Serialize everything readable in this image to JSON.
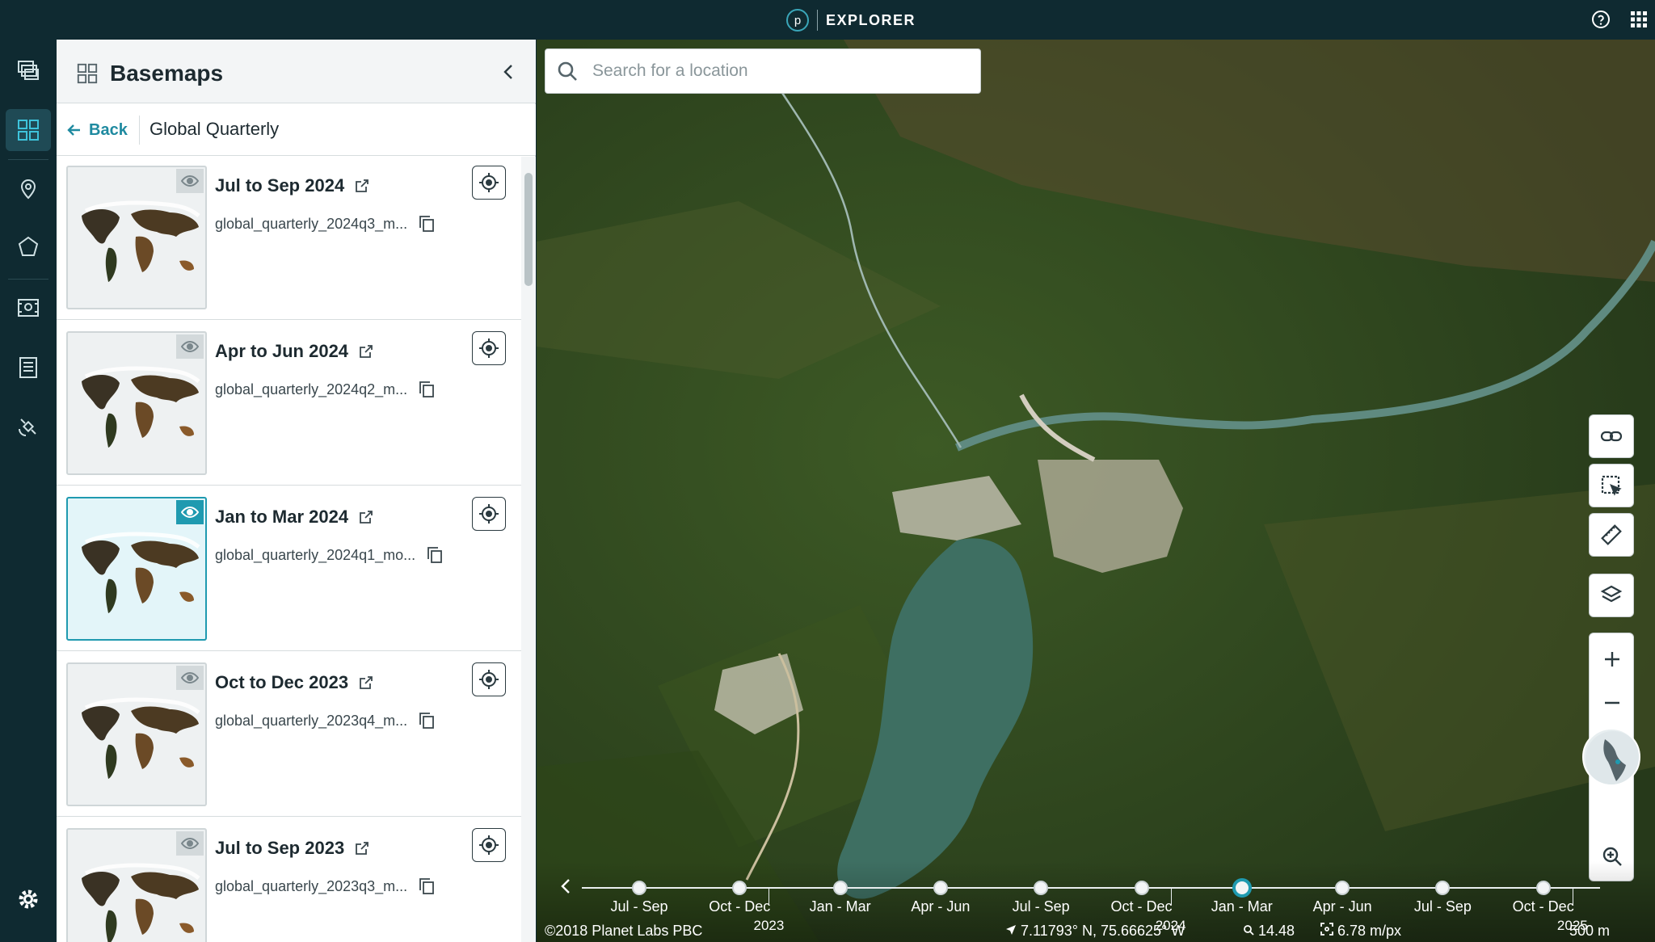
{
  "app": {
    "brand_letter": "p",
    "brand_name": "EXPLORER"
  },
  "panel": {
    "title": "Basemaps",
    "back_label": "Back",
    "collection_title": "Global Quarterly",
    "items": [
      {
        "title": "Jul to Sep 2024",
        "id": "global_quarterly_2024q3_m...",
        "selected": false
      },
      {
        "title": "Apr to Jun 2024",
        "id": "global_quarterly_2024q2_m...",
        "selected": false
      },
      {
        "title": "Jan to Mar 2024",
        "id": "global_quarterly_2024q1_mo...",
        "selected": true
      },
      {
        "title": "Oct to Dec 2023",
        "id": "global_quarterly_2023q4_m...",
        "selected": false
      },
      {
        "title": "Jul to Sep 2023",
        "id": "global_quarterly_2023q3_m...",
        "selected": false
      }
    ]
  },
  "search": {
    "placeholder": "Search for a location"
  },
  "timeline": {
    "labels": [
      "Jul - Sep",
      "Oct - Dec",
      "Jan - Mar",
      "Apr - Jun",
      "Jul - Sep",
      "Oct - Dec",
      "Jan - Mar",
      "Apr - Jun",
      "Jul - Sep",
      "Oct - Dec"
    ],
    "years": [
      "2023",
      "2024",
      "2025"
    ],
    "selected_index": 6
  },
  "status": {
    "copyright": "©2018 Planet Labs PBC",
    "coordinates": "7.11793° N, 75.66625° W",
    "zoom": "14.48",
    "resolution": "6.78 m/px",
    "scale": "500 m"
  },
  "colors": {
    "accent": "#1f9ab0",
    "topbar": "#0f2a31"
  }
}
